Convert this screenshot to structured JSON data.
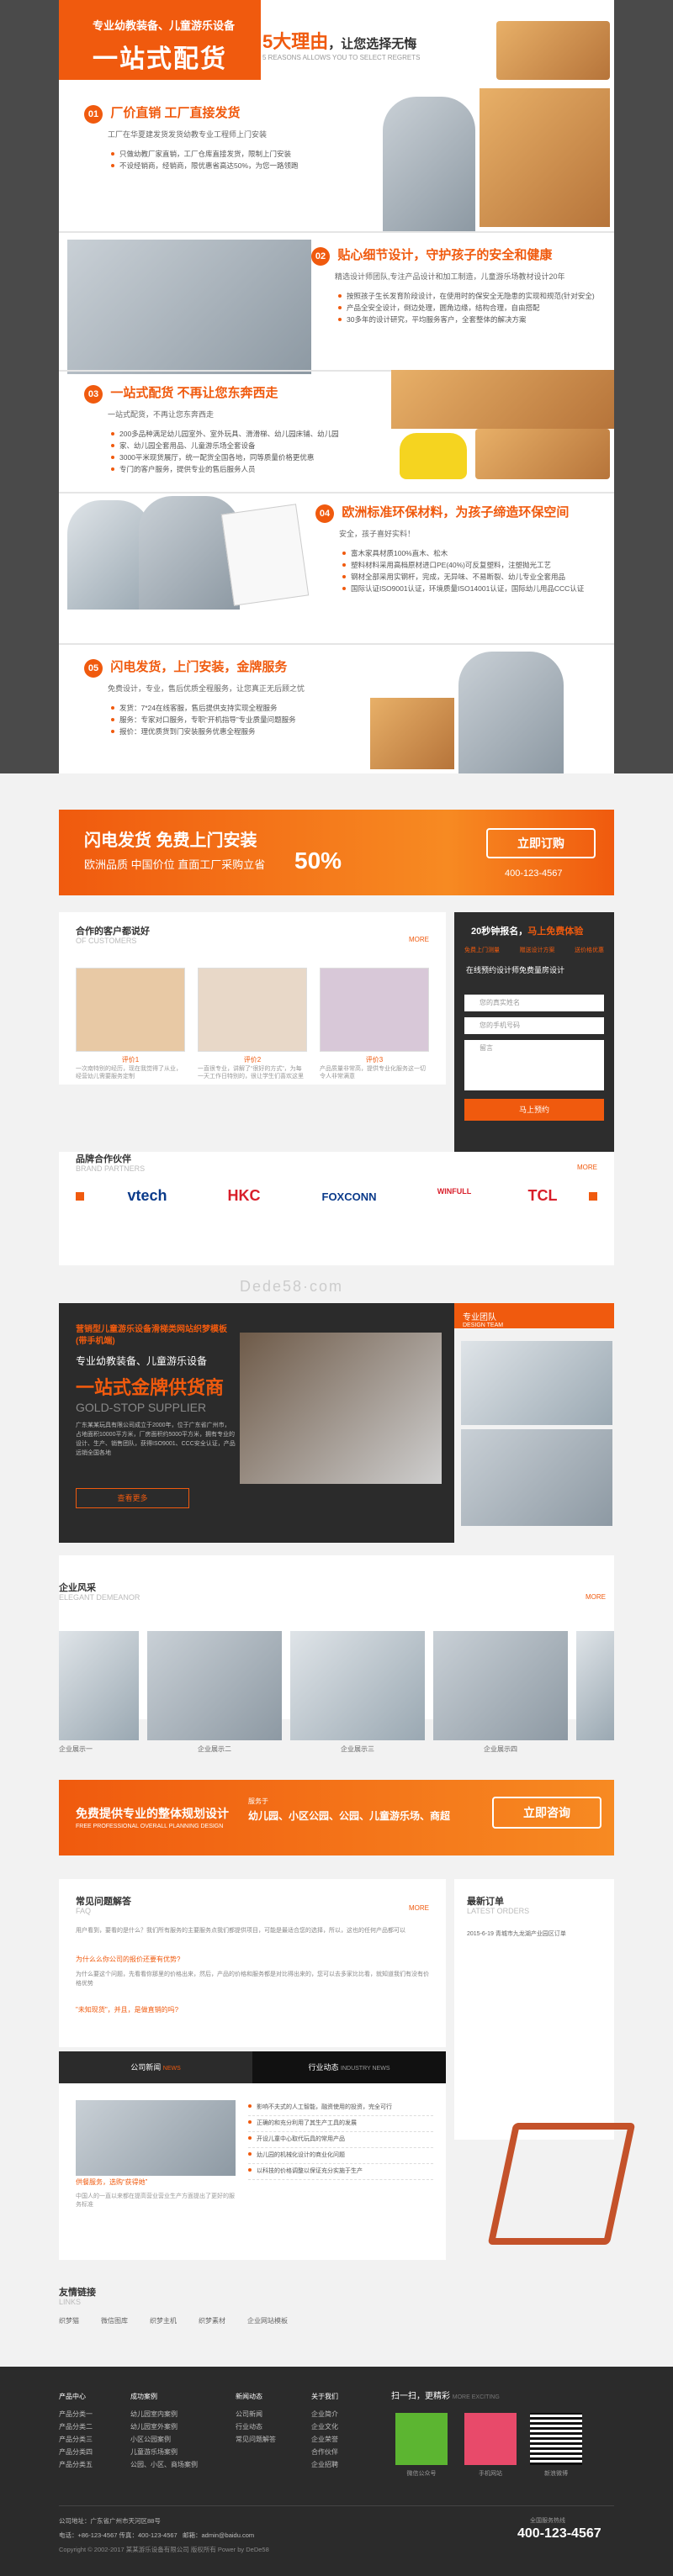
{
  "hero": {
    "tag": "专业幼教装备、儿童游乐设备",
    "big": "一站式配货",
    "reason_num": "5大理由",
    "reason_txt": "，让您选择无悔",
    "reason_en": "5 REASONS ALLOWS YOU TO SELECT REGRETS"
  },
  "reasons": [
    {
      "num": "01",
      "title": "厂价直销 工厂直接发货",
      "sub": "工厂在华夏建发货发货幼教专业工程师上门安装",
      "items": [
        "只做幼教厂家直销，工厂仓库直接发货，限制上门安装",
        "不设经销商，经销商，限优惠省高达50%，为您一路领跑"
      ]
    },
    {
      "num": "02",
      "title": "贴心细节设计，守护孩子的安全和健康",
      "sub": "精选设计师团队,专注产品设计和加工制造，儿童游乐场教材设计20年",
      "items": [
        "按照孩子生长发育阶段设计，在使用时的保安全无隐患的实现和规范(针对安全)",
        "产品全安全设计，倒边处理，圆角边缘，结构合理，自由搭配",
        "30多年的设计研究，平均服务客户，全套整体的解决方案"
      ]
    },
    {
      "num": "03",
      "title": "一站式配货 不再让您东奔西走",
      "sub": "一站式配货，不再让您东奔西走",
      "items": [
        "200多品种满足幼儿园室外、室外玩具、滑滑梯、幼儿园床铺、幼儿园",
        "家、幼儿园全套用品、儿童游乐场全套设备",
        "3000平米现货展厅，统一配货全国各地，同等质量价格更优惠",
        "专门的客户服务，提供专业的售后服务人员"
      ]
    },
    {
      "num": "04",
      "title": "欧洲标准环保材料，为孩子缔造环保空间",
      "sub": "安全，孩子喜好实料！",
      "items": [
        "富木家具材质100%直木、松木",
        "塑料材料采用高档原材进口PE(40%)可反复塑料，注塑抛光工艺",
        "钢材全部采用实钢杆，完成，无异味、不易断裂、幼儿专业全套用品",
        "国际认证ISO9001认证，环境质量ISO14001认证，国际幼儿用品CCC认证"
      ]
    },
    {
      "num": "05",
      "title": "闪电发货，上门安装，金牌服务",
      "sub": "免费设计，专业，售后优质全程服务，让您真正无后顾之忧",
      "items": [
        "发货：7*24在线客服，售后提供支持实现全程服务",
        "服务：专家对口服务，专职“开机指导”专业质量问题服务",
        "报价：理优质货到门安装服务优惠全程服务"
      ]
    }
  ],
  "promo1": {
    "line1": "闪电发货 免费上门安装",
    "line2": "欧洲品质 中国价位 直面工厂采购立省",
    "pct": "50%",
    "btn": "立即订购",
    "phone": "400-123-4567"
  },
  "cases": {
    "title": "合作的客户都说好",
    "en": "OF CUSTOMERS",
    "more": "MORE",
    "items": [
      {
        "n": "评价1",
        "t": "一次南特别的经历，现在我觉得了从业，经营幼儿需要服务定制"
      },
      {
        "n": "评价2",
        "t": "一直很专业，讲解了“很好的方式”，为每一天工作日特别的，很让学生们喜欢这里"
      },
      {
        "n": "评价3",
        "t": "产品质量非常高，提供专业化服务这一切令人非常满意"
      }
    ]
  },
  "quote": {
    "title": "20秒钟报名，",
    "title2": "马上免费体验",
    "row1": [
      "免费上门测量",
      "赠送设计方案",
      "送价格优惠"
    ],
    "caption": "在线预约设计师免费量房设计",
    "f1": "您的真实姓名",
    "f2": "您的手机号码",
    "f3": "留言",
    "btn": "马上预约"
  },
  "brands": {
    "title": "品牌合作伙伴",
    "en": "BRAND PARTNERS",
    "more": "MORE",
    "items": [
      "vtech",
      "HKC",
      "FOXCONN",
      "WINFULL",
      "TCL"
    ]
  },
  "watermark": "Dede58·com",
  "about": {
    "head": "营销型儿童游乐设备滑梯类网站织梦模板(带手机端)",
    "l1": "专业幼教装备、儿童游乐设备",
    "l2": "一站式金牌供货商",
    "l3": "GOLD-STOP SUPPLIER",
    "desc": "广东某某玩具有限公司成立于2000年，位于广东省广州市，占地面积10000平方米，厂房面积约5000平方米，拥有专业的设计、生产、销售团队，获得ISO9001、CCC安全认证，产品远销全国各地",
    "btn": "查看更多",
    "team": "专业团队",
    "team_en": "DESIGN TEAM"
  },
  "env": {
    "title": "企业风采",
    "en": "ELEGANT DEMEANOR",
    "more": "MORE",
    "items": [
      "企业展示一",
      "企业展示二",
      "企业展示三",
      "企业展示四",
      ""
    ]
  },
  "promo2": {
    "l1": "免费提供专业的整体规划设计",
    "l1en": "FREE PROFESSIONAL OVERALL PLANNING DESIGN",
    "mini": "服务于",
    "l2": "幼儿园、小区公园、公园、儿童游乐场、商超",
    "btn": "立即咨询",
    "phone": "400-123-4567"
  },
  "faq": {
    "title": "常见问题解答",
    "en": "FAQ",
    "more": "MORE",
    "intro": "用户看到，要看的是什么？我们所有服务的主要服务点我们都提供项目，可能是最适合您的选择，所以，这也的任何产品都可以",
    "q1": "为什么么你公司的报价还要有优势?",
    "a1": "为什么要这个问题，先看看你那里的价格出来，然后，产品的价格和服务都是对比得出来的，您可以去多家比比看，就知道我们有没有价格优势",
    "q2": "\"未知现货\"，并且，是做直销的吗?",
    "tab1": "公司新闻",
    "tab1en": "NEWS",
    "tab2": "行业动态",
    "tab2en": "INDUSTRY NEWS",
    "news_img_cap": "供餐服务，选购“获得她”",
    "news_desc": "中国人的一直以来都在提高营业营业生产方面提出了更好的服务标准",
    "news_items": [
      "影响不夫式的人工智能，融资使用的投资，完全可行",
      "正确的和充分利用了其生产工具的发展",
      "开设儿童中心取代玩具的常用产品",
      "幼儿园的机械化设计的商业化问题",
      "以科技的价格调整以保证充分实施于生产"
    ],
    "orders": "最新订单",
    "orders_en": "LATEST ORDERS",
    "order_item": "2015-6-19 青城市九龙湖产业园区订单"
  },
  "links": {
    "title": "友情链接",
    "en": "LINKS",
    "items": [
      "织梦猫",
      "微信图库",
      "织梦主机",
      "织梦素材",
      "企业网站模板"
    ]
  },
  "footer": {
    "cols": [
      {
        "h": "产品中心",
        "items": [
          "产品分类一",
          "产品分类二",
          "产品分类三",
          "产品分类四",
          "产品分类五"
        ]
      },
      {
        "h": "成功案例",
        "items": [
          "幼儿园室内案例",
          "幼儿园室外案例",
          "小区公园案例",
          "儿童游乐场案例",
          "公园、小区、商场案例"
        ]
      },
      {
        "h": "新闻动态",
        "items": [
          "公司新闻",
          "行业动态",
          "常见问题解答"
        ]
      },
      {
        "h": "关于我们",
        "items": [
          "企业简介",
          "企业文化",
          "企业荣誉",
          "合作伙伴",
          "企业招聘"
        ]
      }
    ],
    "scan": "扫一扫，更精彩",
    "scan_en": "MORE EXCITING",
    "qr": [
      "微信公众号",
      "手机网站",
      "新浪微博"
    ],
    "tel_lbl": "全国服务热线",
    "tel": "400-123-4567",
    "addr": "公司地址：广东省广州市天河区88号",
    "phone": "电话：+86-123-4567 传真：400-123-4567",
    "mail": "邮箱：admin@baidu.com",
    "copy": "Copyright © 2002-2017 某某游乐设备有限公司 版权所有 Power by DeDe58"
  }
}
